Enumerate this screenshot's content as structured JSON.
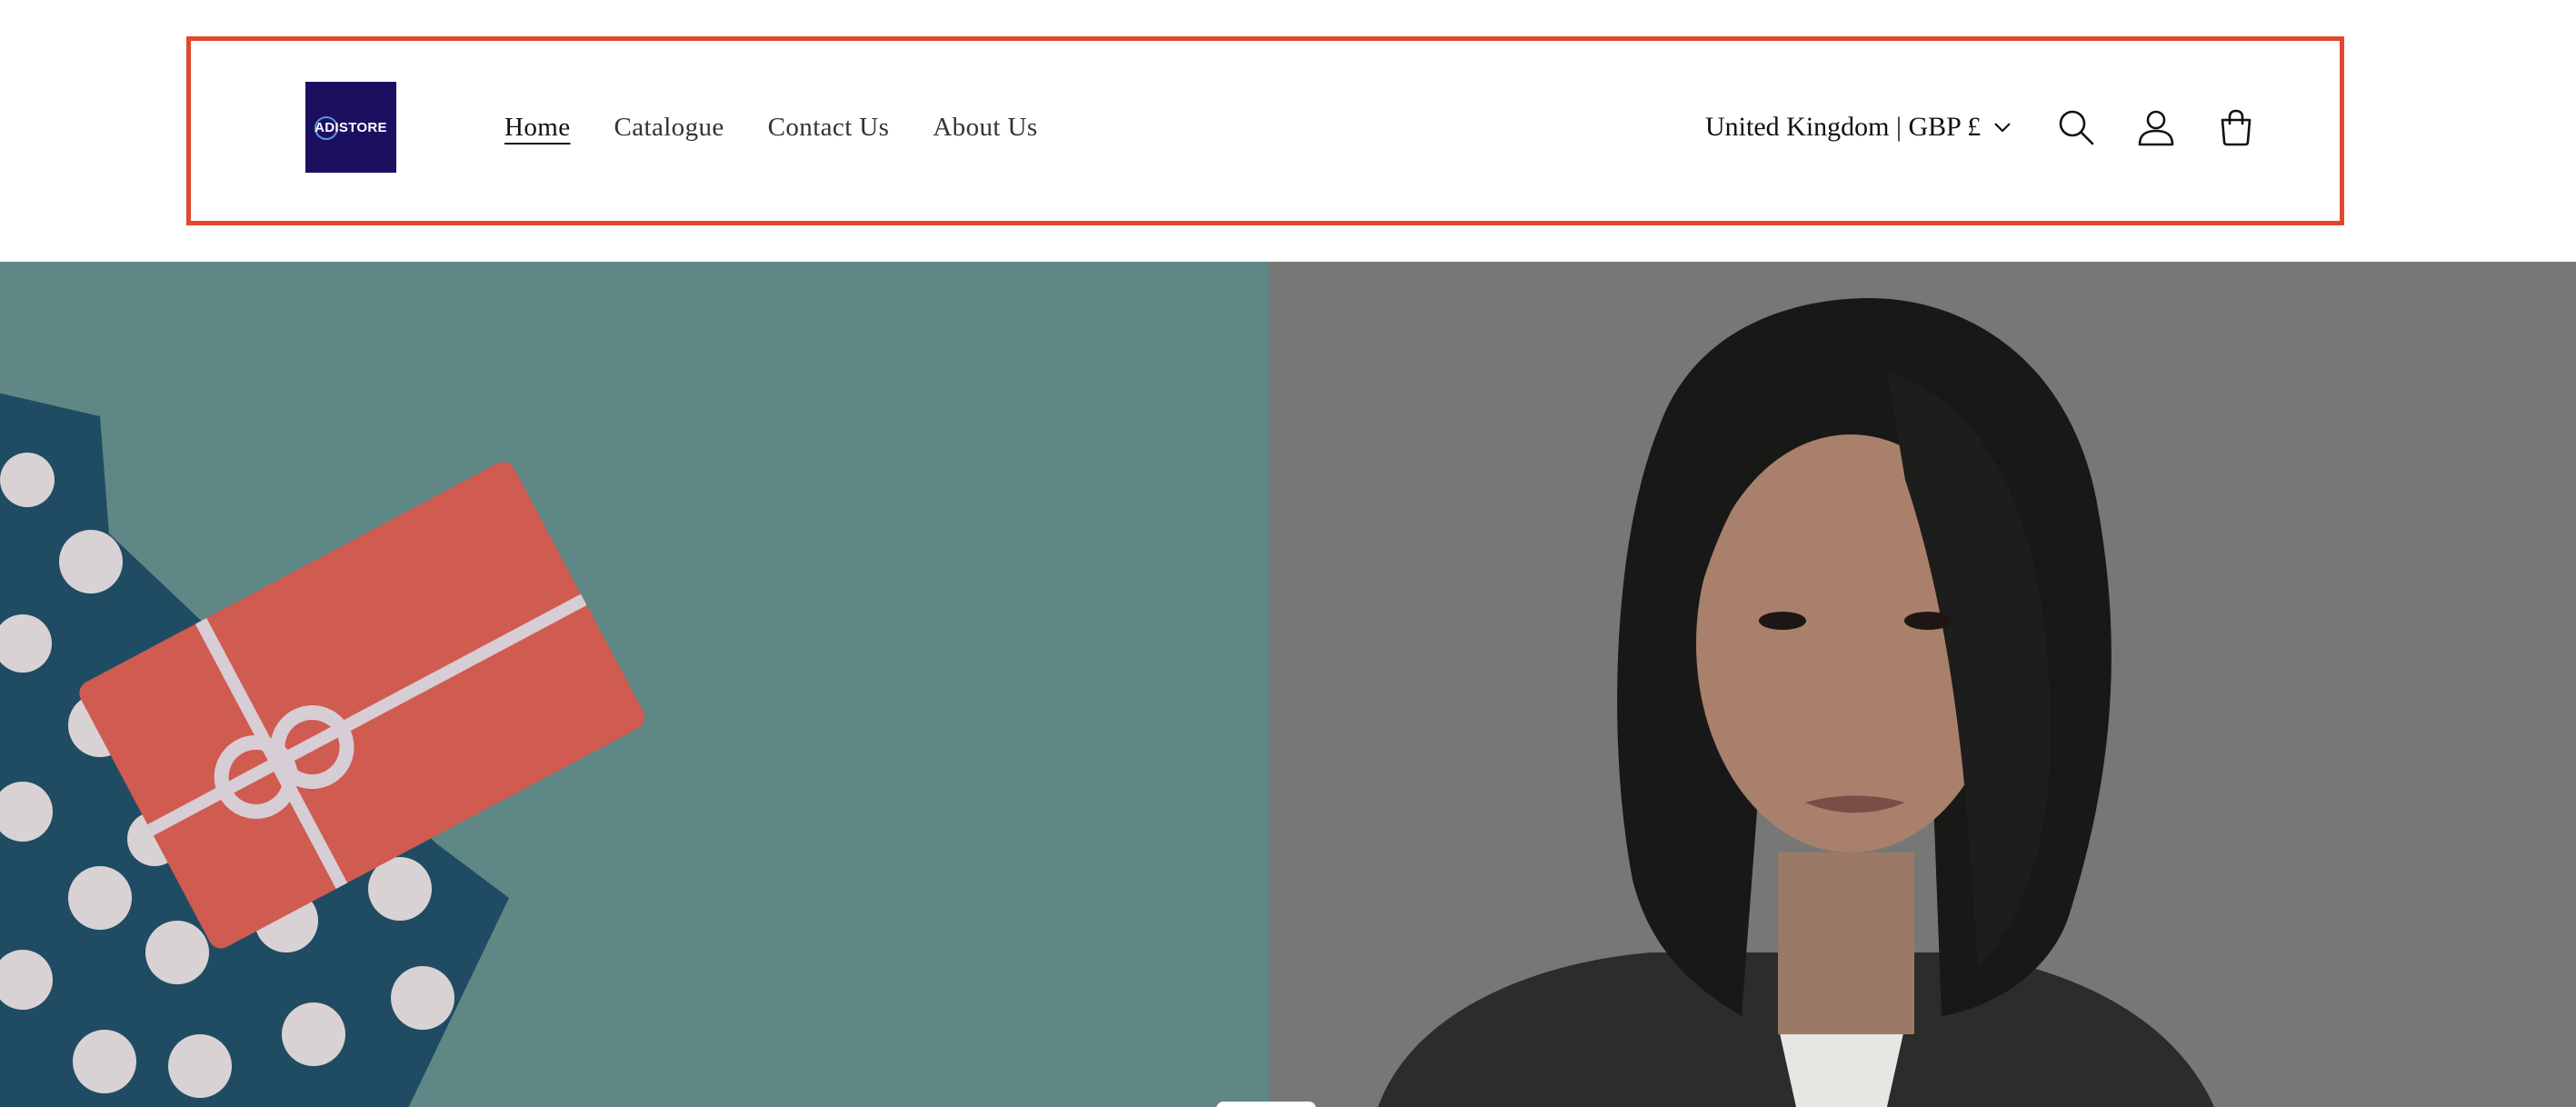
{
  "header": {
    "logo_text": "ADISTORE",
    "nav": [
      {
        "label": "Home",
        "active": true
      },
      {
        "label": "Catalogue"
      },
      {
        "label": "Contact Us"
      },
      {
        "label": "About Us"
      }
    ],
    "locale_label": "United Kingdom | GBP £",
    "icons": [
      "chevron-down-icon",
      "search-icon",
      "account-icon",
      "cart-icon"
    ]
  },
  "colors": {
    "highlight_border": "#e4472f",
    "logo_bg": "#1b1060",
    "hero_left_bg": "#5f8786",
    "hero_right_bg": "#777876",
    "gift_card": "#d05b50",
    "polka_bag": "#1f4c63"
  },
  "hero": {
    "left_image": "gift-card-envelope-image",
    "right_image": "woman-portrait-image"
  }
}
